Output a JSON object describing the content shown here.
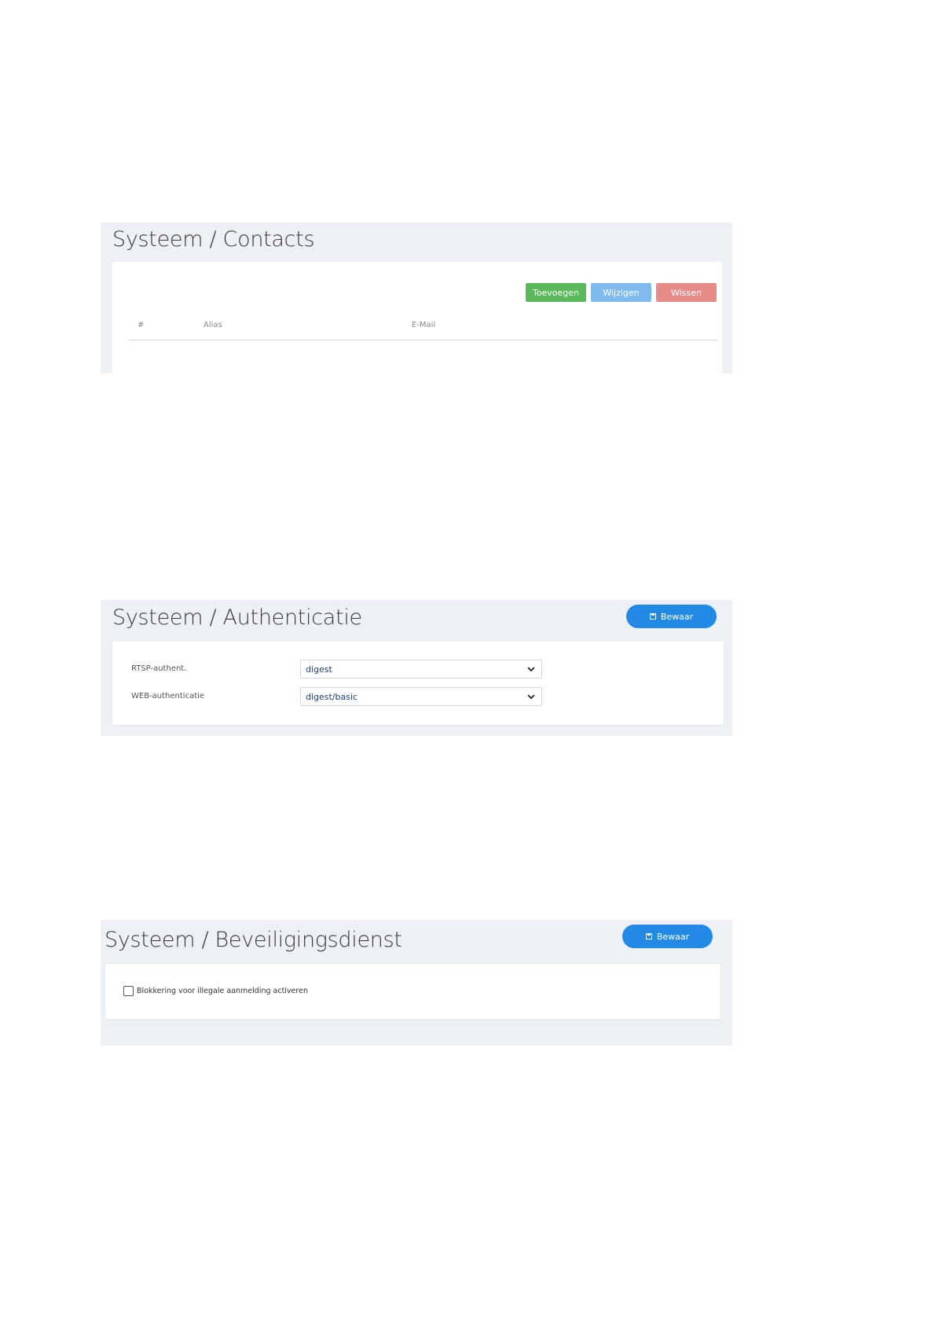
{
  "contacts_panel": {
    "title": "Systeem / Contacts",
    "buttons": {
      "add_label": "Toevoegen",
      "edit_label": "Wijzigen",
      "delete_label": "Wissen"
    },
    "table": {
      "columns": [
        "#",
        "Alias",
        "E-Mail"
      ],
      "rows": []
    }
  },
  "auth_panel": {
    "title": "Systeem / Authenticatie",
    "save_label": "Bewaar",
    "fields": [
      {
        "label": "RTSP-authent.",
        "value": "digest"
      },
      {
        "label": "WEB-authenticatie",
        "value": "digest/basic"
      }
    ]
  },
  "security_panel": {
    "title": "Systeem / Beveiligingsdienst",
    "save_label": "Bewaar",
    "checkbox": {
      "label": "Blokkering voor illegale aanmelding activeren",
      "checked": false
    }
  },
  "colors": {
    "panel_background": "#edf1f5",
    "add_button": "#5cb85c",
    "edit_button": "#7fbbec",
    "delete_button": "#e78a8a",
    "save_button": "#2289e4",
    "select_text": "#1f3e7a"
  },
  "icons": [
    "save-icon",
    "chevron-down-icon"
  ]
}
